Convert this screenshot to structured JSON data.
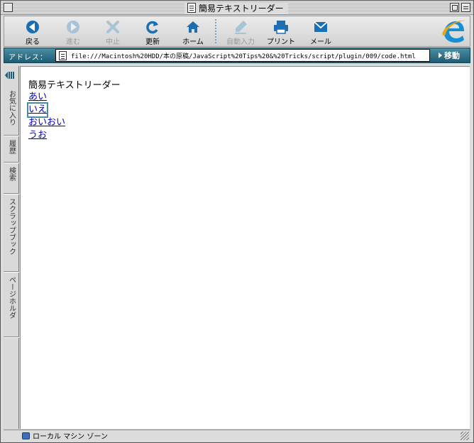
{
  "window": {
    "title": "簡易テキストリーダー"
  },
  "toolbar": {
    "buttons": [
      {
        "label": "戻る",
        "icon": "back-arrow-icon",
        "enabled": true
      },
      {
        "label": "進む",
        "icon": "forward-arrow-icon",
        "enabled": false
      },
      {
        "label": "中止",
        "icon": "stop-x-icon",
        "enabled": false
      },
      {
        "label": "更新",
        "icon": "refresh-icon",
        "enabled": true
      },
      {
        "label": "ホーム",
        "icon": "home-icon",
        "enabled": true
      },
      {
        "label": "自動入力",
        "icon": "autofill-icon",
        "enabled": false
      },
      {
        "label": "プリント",
        "icon": "printer-icon",
        "enabled": true
      },
      {
        "label": "メール",
        "icon": "mail-icon",
        "enabled": true
      }
    ]
  },
  "address": {
    "label": "アドレス：",
    "url": "file:///Macintosh%20HDD/本の原稿/JavaScript%20Tips%20&%20Tricks/script/plugin/009/code.html",
    "go_label": "移動"
  },
  "explorer": {
    "tabs": [
      "お気に入り",
      "履歴",
      "検索",
      "スクラップブック",
      "ページホルダ"
    ]
  },
  "page": {
    "heading": "簡易テキストリーダー",
    "links": [
      "あい",
      "いえ",
      "おいおい",
      "うお"
    ],
    "focused_index": 1
  },
  "status": {
    "zone": "ローカル マシン ゾーン"
  },
  "colors": {
    "accent": "#1d5d73",
    "link": "#0000c8",
    "icon_blue": "#1a6fb4"
  }
}
